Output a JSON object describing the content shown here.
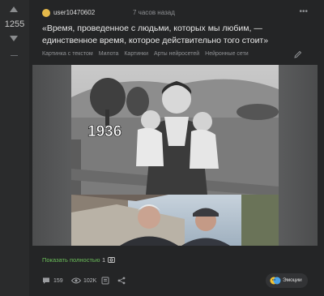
{
  "vote": {
    "rating": "1255"
  },
  "post": {
    "username": "user10470602",
    "time": "7 часов назад",
    "title": "«Время, проведенное с людьми, которых мы любим, — единственное время, которое действительно того стоит»",
    "tags": [
      "Картинка с текстом",
      "Милота",
      "Картинки",
      "Арты нейросетей",
      "Нейронные сети"
    ],
    "image_overlay": "1936",
    "show_full": "Показать полностью",
    "image_count": "1"
  },
  "footer": {
    "comments": "159",
    "views": "102K",
    "emoji_label": "Эмоции"
  },
  "icons": {
    "vote_up": "arrow-up-icon",
    "vote_down": "arrow-down-icon",
    "more": "more-horizontal-icon",
    "edit": "pencil-icon",
    "camera": "camera-icon",
    "comments": "comment-icon",
    "views": "eye-icon",
    "save": "bookmark-icon",
    "share": "share-icon",
    "emoji": "emoji-faces-icon"
  },
  "colors": {
    "background": "#242526",
    "link_green": "#6bbf5a",
    "muted": "#8f9194"
  }
}
